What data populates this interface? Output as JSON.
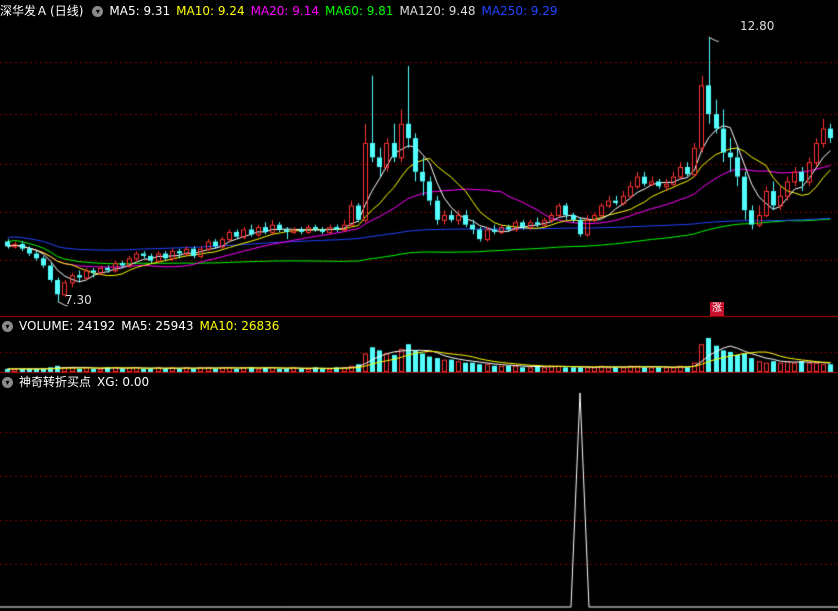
{
  "price_panel": {
    "stock_name": "深华发Ａ",
    "period": "(日线)",
    "ma_items": [
      {
        "label": "MA5: 9.31",
        "color": "#ffffff"
      },
      {
        "label": "MA10: 9.24",
        "color": "#ffff00"
      },
      {
        "label": "MA20: 9.14",
        "color": "#ff00ff"
      },
      {
        "label": "MA60: 9.81",
        "color": "#00ff00"
      },
      {
        "label": "MA120: 9.48",
        "color": "#dddddd"
      },
      {
        "label": "MA250: 9.29",
        "color": "#2244ff"
      }
    ],
    "high_label": "12.80",
    "low_label": "7.30",
    "badge": "涨"
  },
  "volume_panel": {
    "label": "VOLUME: 24192",
    "ma5": "MA5: 25943",
    "ma10": "MA10: 26836"
  },
  "indicator_panel": {
    "name": "神奇转折买点",
    "value": "XG: 0.00"
  },
  "colors": {
    "up": "#ff3232",
    "down": "#54ffff",
    "grid": "#7a0000",
    "divider": "#b00000",
    "ma5": "#ffffff",
    "ma10": "#ffff00",
    "ma20": "#ff00ff",
    "ma60": "#00ff00",
    "ma250": "#2244ff"
  },
  "chart_data": {
    "type": "candlestick",
    "price_axis_range": [
      7.0,
      13.2
    ],
    "high": 12.8,
    "low": 7.3,
    "candles": [
      [
        8.55,
        8.45,
        8.6,
        8.4
      ],
      [
        8.45,
        8.5,
        8.55,
        8.4
      ],
      [
        8.5,
        8.4,
        8.55,
        8.35
      ],
      [
        8.4,
        8.3,
        8.45,
        8.25
      ],
      [
        8.3,
        8.2,
        8.35,
        8.15
      ],
      [
        8.2,
        8.05,
        8.25,
        8.0
      ],
      [
        8.05,
        7.75,
        8.1,
        7.7
      ],
      [
        7.75,
        7.45,
        7.8,
        7.3
      ],
      [
        7.45,
        7.7,
        7.75,
        7.4
      ],
      [
        7.7,
        7.85,
        7.9,
        7.6
      ],
      [
        7.85,
        7.8,
        7.95,
        7.7
      ],
      [
        7.8,
        7.95,
        8.0,
        7.75
      ],
      [
        7.95,
        7.9,
        8.0,
        7.8
      ],
      [
        7.9,
        8.0,
        8.05,
        7.85
      ],
      [
        8.0,
        7.95,
        8.05,
        7.9
      ],
      [
        7.95,
        8.1,
        8.15,
        7.9
      ],
      [
        8.1,
        8.05,
        8.15,
        8.0
      ],
      [
        8.05,
        8.2,
        8.25,
        8.0
      ],
      [
        8.2,
        8.3,
        8.35,
        8.15
      ],
      [
        8.3,
        8.25,
        8.35,
        8.2
      ],
      [
        8.25,
        8.15,
        8.3,
        8.1
      ],
      [
        8.15,
        8.3,
        8.35,
        8.1
      ],
      [
        8.3,
        8.2,
        8.35,
        8.15
      ],
      [
        8.2,
        8.35,
        8.4,
        8.15
      ],
      [
        8.35,
        8.3,
        8.4,
        8.2
      ],
      [
        8.3,
        8.4,
        8.45,
        8.25
      ],
      [
        8.4,
        8.25,
        8.45,
        8.2
      ],
      [
        8.25,
        8.4,
        8.45,
        8.2
      ],
      [
        8.4,
        8.55,
        8.6,
        8.35
      ],
      [
        8.55,
        8.45,
        8.6,
        8.4
      ],
      [
        8.45,
        8.6,
        8.65,
        8.4
      ],
      [
        8.6,
        8.75,
        8.8,
        8.55
      ],
      [
        8.75,
        8.65,
        8.8,
        8.6
      ],
      [
        8.65,
        8.8,
        8.85,
        8.6
      ],
      [
        8.8,
        8.7,
        8.9,
        8.65
      ],
      [
        8.7,
        8.85,
        8.9,
        8.65
      ],
      [
        8.85,
        8.75,
        8.95,
        8.7
      ],
      [
        8.75,
        8.9,
        9.0,
        8.7
      ],
      [
        8.9,
        8.8,
        8.95,
        8.75
      ],
      [
        8.8,
        8.75,
        8.85,
        8.6
      ],
      [
        8.75,
        8.8,
        8.85,
        8.7
      ],
      [
        8.8,
        8.75,
        8.85,
        8.7
      ],
      [
        8.75,
        8.85,
        8.9,
        8.7
      ],
      [
        8.85,
        8.8,
        8.9,
        8.75
      ],
      [
        8.8,
        8.75,
        8.85,
        8.7
      ],
      [
        8.75,
        8.85,
        8.9,
        8.7
      ],
      [
        8.85,
        8.8,
        8.9,
        8.75
      ],
      [
        8.8,
        8.9,
        9.0,
        8.75
      ],
      [
        8.9,
        9.3,
        9.4,
        8.85
      ],
      [
        9.3,
        9.0,
        9.35,
        8.95
      ],
      [
        9.0,
        10.6,
        11.0,
        8.95
      ],
      [
        10.6,
        10.3,
        12.0,
        10.2
      ],
      [
        10.3,
        10.1,
        10.5,
        9.9
      ],
      [
        10.1,
        10.6,
        10.7,
        10.0
      ],
      [
        10.6,
        10.3,
        11.0,
        10.2
      ],
      [
        10.3,
        11.0,
        11.3,
        10.2
      ],
      [
        11.0,
        10.7,
        12.2,
        10.5
      ],
      [
        10.7,
        10.0,
        10.8,
        9.8
      ],
      [
        10.0,
        9.8,
        10.3,
        9.5
      ],
      [
        9.8,
        9.4,
        9.9,
        9.3
      ],
      [
        9.4,
        9.0,
        9.5,
        8.9
      ],
      [
        9.0,
        9.1,
        9.2,
        8.9
      ],
      [
        9.1,
        9.0,
        9.2,
        8.95
      ],
      [
        9.0,
        9.1,
        9.2,
        8.9
      ],
      [
        9.1,
        8.9,
        9.2,
        8.85
      ],
      [
        8.9,
        8.8,
        9.0,
        8.7
      ],
      [
        8.8,
        8.6,
        8.85,
        8.55
      ],
      [
        8.6,
        8.8,
        8.85,
        8.55
      ],
      [
        8.8,
        8.75,
        8.9,
        8.7
      ],
      [
        8.75,
        8.85,
        8.9,
        8.7
      ],
      [
        8.85,
        8.8,
        8.9,
        8.75
      ],
      [
        8.8,
        8.95,
        9.0,
        8.75
      ],
      [
        8.95,
        8.85,
        9.0,
        8.8
      ],
      [
        8.85,
        8.95,
        9.0,
        8.8
      ],
      [
        8.95,
        8.9,
        9.05,
        8.85
      ],
      [
        8.9,
        9.0,
        9.05,
        8.85
      ],
      [
        9.0,
        9.1,
        9.15,
        8.95
      ],
      [
        9.1,
        9.3,
        9.35,
        9.05
      ],
      [
        9.3,
        9.1,
        9.35,
        9.0
      ],
      [
        9.1,
        9.0,
        9.15,
        8.95
      ],
      [
        9.0,
        8.7,
        9.05,
        8.65
      ],
      [
        8.7,
        9.0,
        9.1,
        8.65
      ],
      [
        9.0,
        9.1,
        9.15,
        8.95
      ],
      [
        9.1,
        9.3,
        9.35,
        9.05
      ],
      [
        9.3,
        9.4,
        9.5,
        9.25
      ],
      [
        9.4,
        9.35,
        9.5,
        9.3
      ],
      [
        9.35,
        9.5,
        9.6,
        9.3
      ],
      [
        9.5,
        9.7,
        9.8,
        9.45
      ],
      [
        9.7,
        9.9,
        10.0,
        9.65
      ],
      [
        9.9,
        9.75,
        10.0,
        9.7
      ],
      [
        9.75,
        9.8,
        9.9,
        9.7
      ],
      [
        9.8,
        9.7,
        9.85,
        9.65
      ],
      [
        9.7,
        9.75,
        9.85,
        9.6
      ],
      [
        9.75,
        9.9,
        10.0,
        9.7
      ],
      [
        9.9,
        10.1,
        10.2,
        9.85
      ],
      [
        10.1,
        9.95,
        10.2,
        9.9
      ],
      [
        9.95,
        10.5,
        10.6,
        9.9
      ],
      [
        10.5,
        11.8,
        12.0,
        10.4
      ],
      [
        11.8,
        11.2,
        12.8,
        11.0
      ],
      [
        11.2,
        10.9,
        11.5,
        10.8
      ],
      [
        10.9,
        10.4,
        11.3,
        10.2
      ],
      [
        10.4,
        10.3,
        10.7,
        10.0
      ],
      [
        10.3,
        9.9,
        10.5,
        9.7
      ],
      [
        9.9,
        9.2,
        10.0,
        9.0
      ],
      [
        9.2,
        8.9,
        9.3,
        8.8
      ],
      [
        8.9,
        9.1,
        9.3,
        8.85
      ],
      [
        9.1,
        9.6,
        9.7,
        9.05
      ],
      [
        9.6,
        9.3,
        9.8,
        9.2
      ],
      [
        9.3,
        9.5,
        9.7,
        9.2
      ],
      [
        9.5,
        9.8,
        9.9,
        9.4
      ],
      [
        9.8,
        10.0,
        10.1,
        9.7
      ],
      [
        10.0,
        9.8,
        10.1,
        9.6
      ],
      [
        9.8,
        10.2,
        10.3,
        9.7
      ],
      [
        10.2,
        10.6,
        10.7,
        10.1
      ],
      [
        10.6,
        10.9,
        11.1,
        10.5
      ],
      [
        10.9,
        10.7,
        11.0,
        10.6
      ]
    ],
    "volume": [
      2,
      2,
      2,
      2,
      2,
      2,
      3,
      4,
      3,
      3,
      2,
      3,
      2,
      2,
      3,
      3,
      2,
      3,
      3,
      2,
      2,
      3,
      2,
      3,
      2,
      3,
      2,
      3,
      3,
      2,
      3,
      3,
      2,
      3,
      3,
      2,
      3,
      3,
      2,
      2,
      3,
      2,
      2,
      3,
      2,
      2,
      3,
      3,
      4,
      5,
      12,
      16,
      14,
      12,
      11,
      15,
      18,
      14,
      12,
      10,
      9,
      8,
      8,
      7,
      6,
      6,
      5,
      5,
      4,
      4,
      4,
      4,
      3,
      3,
      4,
      3,
      4,
      4,
      3,
      3,
      3,
      3,
      3,
      4,
      3,
      3,
      3,
      4,
      4,
      3,
      3,
      3,
      3,
      3,
      4,
      3,
      6,
      18,
      22,
      17,
      14,
      13,
      11,
      12,
      9,
      7,
      6,
      7,
      6,
      7,
      6,
      7,
      6,
      6,
      5,
      5
    ],
    "xg_signal_index": 80
  }
}
